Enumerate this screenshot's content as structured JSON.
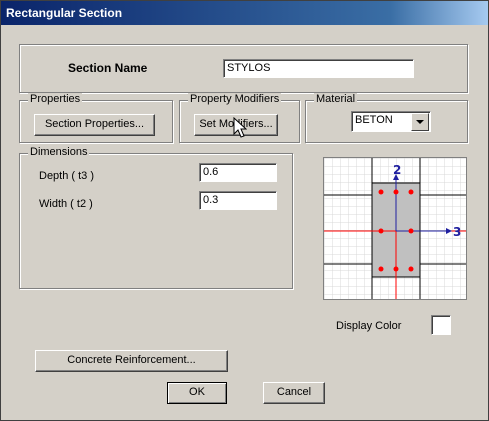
{
  "window": {
    "title": "Rectangular Section"
  },
  "section": {
    "name_label": "Section Name",
    "name_value": "STYLOS"
  },
  "properties": {
    "group_label": "Properties",
    "button_label": "Section Properties..."
  },
  "modifiers": {
    "group_label": "Property Modifiers",
    "button_label": "Set Modifiers..."
  },
  "material": {
    "group_label": "Material",
    "selected": "BETON"
  },
  "dimensions": {
    "group_label": "Dimensions",
    "depth_label": "Depth  ( t3 )",
    "depth_value": "0.6",
    "width_label": "Width  ( t2 )",
    "width_value": "0.3"
  },
  "preview": {
    "axis_2": "2",
    "axis_3": "3"
  },
  "display_color": {
    "label": "Display Color"
  },
  "reinforcement": {
    "button_label": "Concrete Reinforcement..."
  },
  "actions": {
    "ok_label": "OK",
    "cancel_label": "Cancel"
  },
  "colors": {
    "title_bar": "#0a246a",
    "rebar": "#ff0000",
    "axis": "#2020a0",
    "section_fill": "#c0c0c0"
  }
}
